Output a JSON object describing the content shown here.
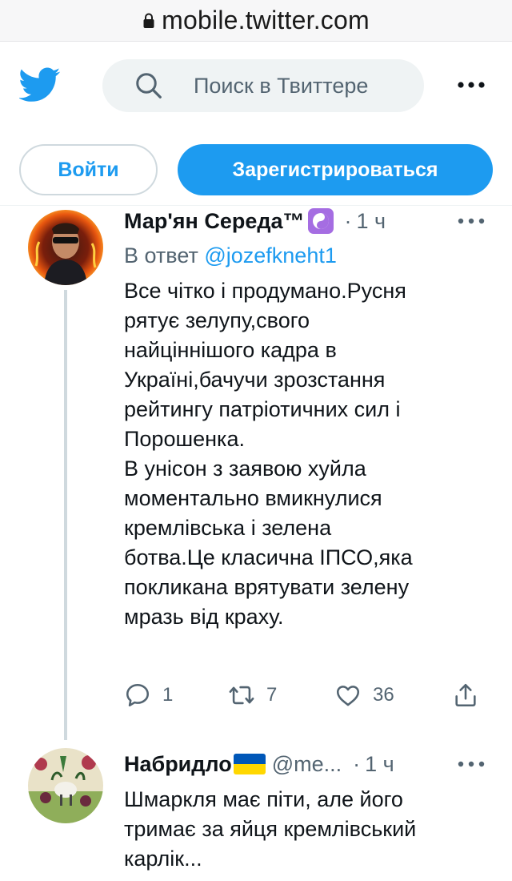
{
  "browser": {
    "url": "mobile.twitter.com"
  },
  "topbar": {
    "logo": "twitter-bird-icon",
    "search_placeholder": "Поиск в Твиттере"
  },
  "auth": {
    "login_label": "Войти",
    "signup_label": "Зарегистрироваться"
  },
  "colors": {
    "accent": "#1d9bf0",
    "text": "#0f1419",
    "muted": "#536471",
    "line": "#cfd9de"
  },
  "tweets": [
    {
      "name": "Мар'ян Середа™",
      "badge": "yin-yang-emoji",
      "dot": "·",
      "time": "1 ч",
      "reply_prefix": "В ответ",
      "reply_to": "@jozefkneht1",
      "lines": [
        "Все чітко і продумано.Русня",
        "рятує зелупу,свого",
        "найціннішого кадра в",
        "Україні,бачучи зрозстання",
        "рейтингу патріотичних сил і",
        "Порошенка.",
        "В унісон з заявою хуйла",
        "моментально вмикнулися",
        "кремлівська і зелена",
        "ботва.Це класична ІПСО,яка",
        "покликана врятувати зелену",
        "мразь від краху."
      ],
      "replies": "1",
      "retweets": "7",
      "likes": "36"
    },
    {
      "name": "Набридло",
      "badge": "ukraine-flag-emoji",
      "handle": "@me...",
      "dot": "·",
      "time": "1 ч",
      "lines": [
        "Шмаркля має піти, але його",
        "тримає за яйця кремлівський",
        "карлік..."
      ]
    }
  ]
}
